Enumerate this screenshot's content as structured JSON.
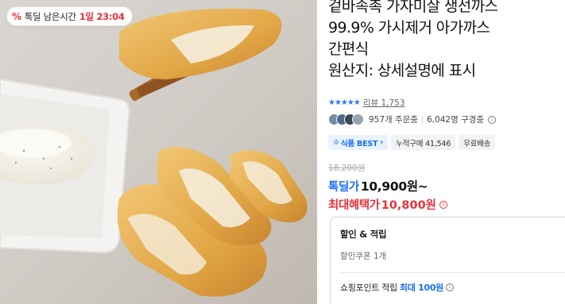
{
  "image": {
    "alt_semantic": "fried-fish-cutlet-photo"
  },
  "deal_badge": {
    "icon": "percent-icon",
    "label": "톡딜 남은시간",
    "time": "1일 23:04"
  },
  "product": {
    "title_lines": [
      "겉바속촉 가자미살 생선까스",
      "99.9% 가시제거 아가까스",
      "간편식",
      "원산지: 상세설명에 표시"
    ]
  },
  "rating": {
    "stars": "★★★★★",
    "score_fraction": 0.9,
    "review_label": "리뷰 1,753"
  },
  "activity": {
    "ordering": "957개 주문중",
    "viewing": "6,042명 구경중"
  },
  "chips": {
    "best": "식품 BEST",
    "cumulative": "누적구매 41,546",
    "shipping": "무료배송"
  },
  "price": {
    "original": "18,200원",
    "deal_label": "톡딜가",
    "deal_price": "10,900원~",
    "max_label": "최대혜택가",
    "max_price": "10,800원"
  },
  "benefits": {
    "heading": "할인 & 적립",
    "coupon": "할인쿠폰 1개",
    "points_prefix": "쇼핑포인트 적립",
    "points_highlight": "최대 100원"
  },
  "colors": {
    "accent_blue": "#1a6ff0",
    "accent_red": "#e8323c"
  }
}
